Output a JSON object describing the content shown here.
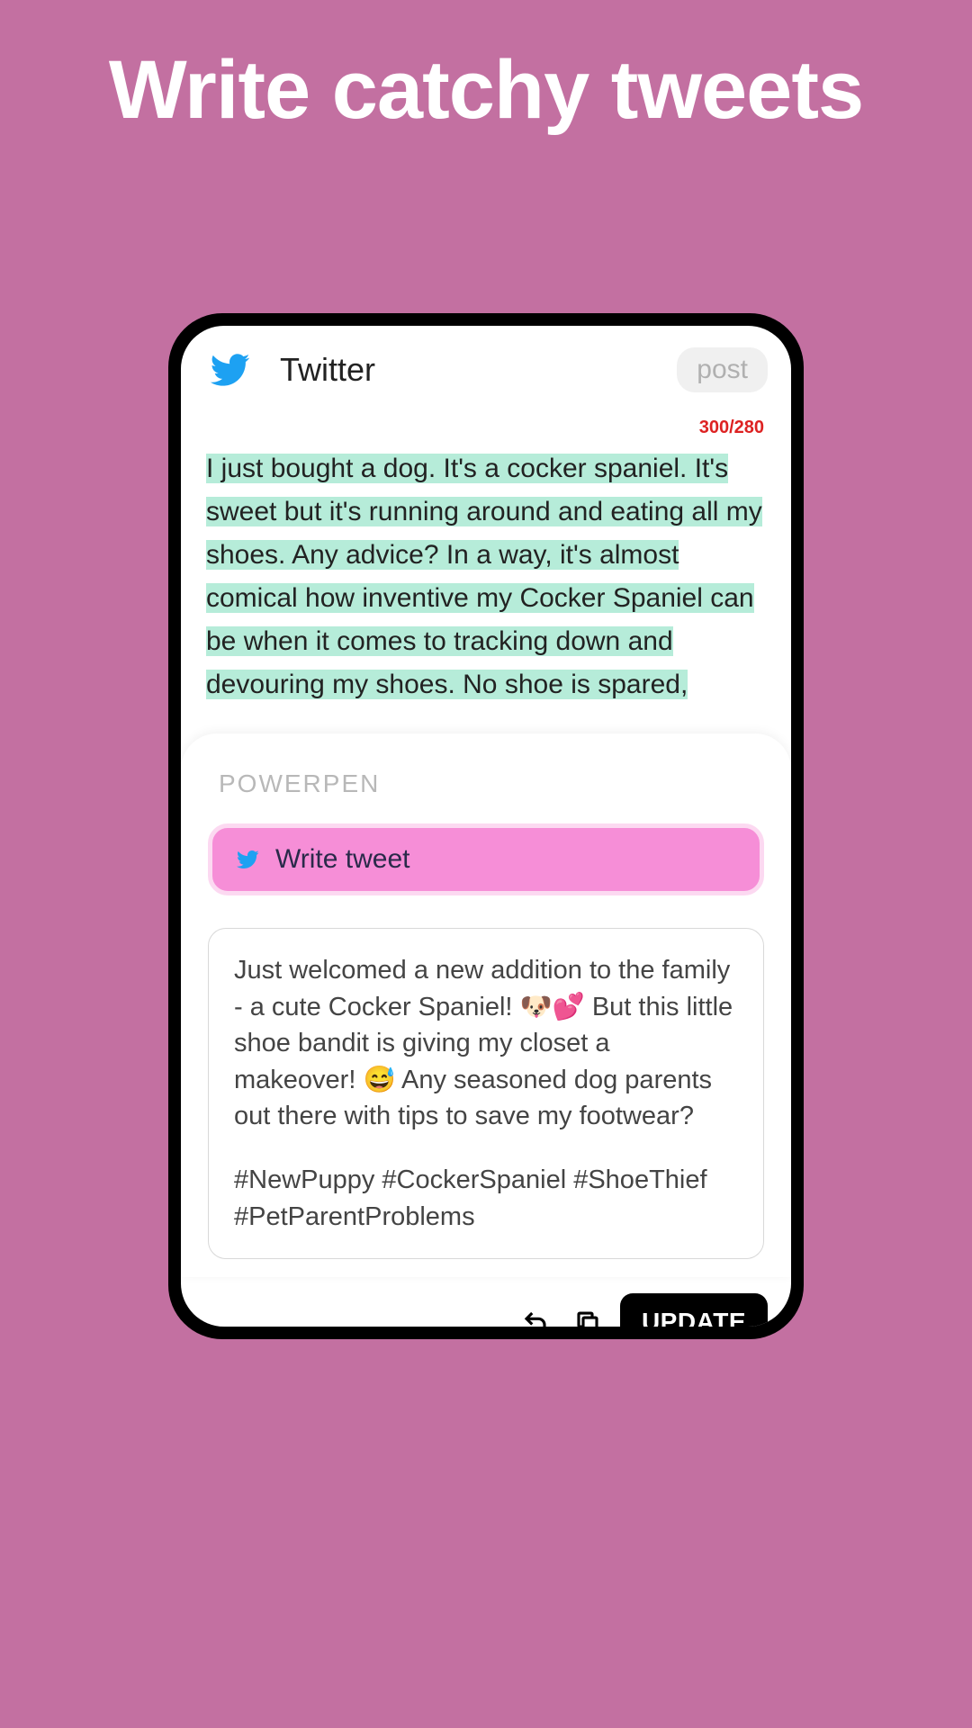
{
  "promo": {
    "headline": "Write catchy tweets"
  },
  "header": {
    "title": "Twitter",
    "post_label": "post"
  },
  "compose": {
    "char_counter": "300/280",
    "text": "I just bought a dog. It's a cocker spaniel. It's sweet but it's running around and eating all my shoes. Any advice? In a way, it's almost comical how inventive my Cocker Spaniel can be when it comes to tracking down and devouring my shoes. No shoe is spared,"
  },
  "powerpen": {
    "label": "POWERPEN",
    "write_tweet_label": "Write tweet",
    "result_body": "Just welcomed a new addition to the family - a cute Cocker Spaniel! 🐶💕 But this little shoe bandit is giving my closet a makeover! 😅 Any seasoned dog parents out there with tips to save my footwear?",
    "result_hashtags": "#NewPuppy #CockerSpaniel #ShoeThief #PetParentProblems"
  },
  "toolbar": {
    "update_label": "UPDATE"
  }
}
